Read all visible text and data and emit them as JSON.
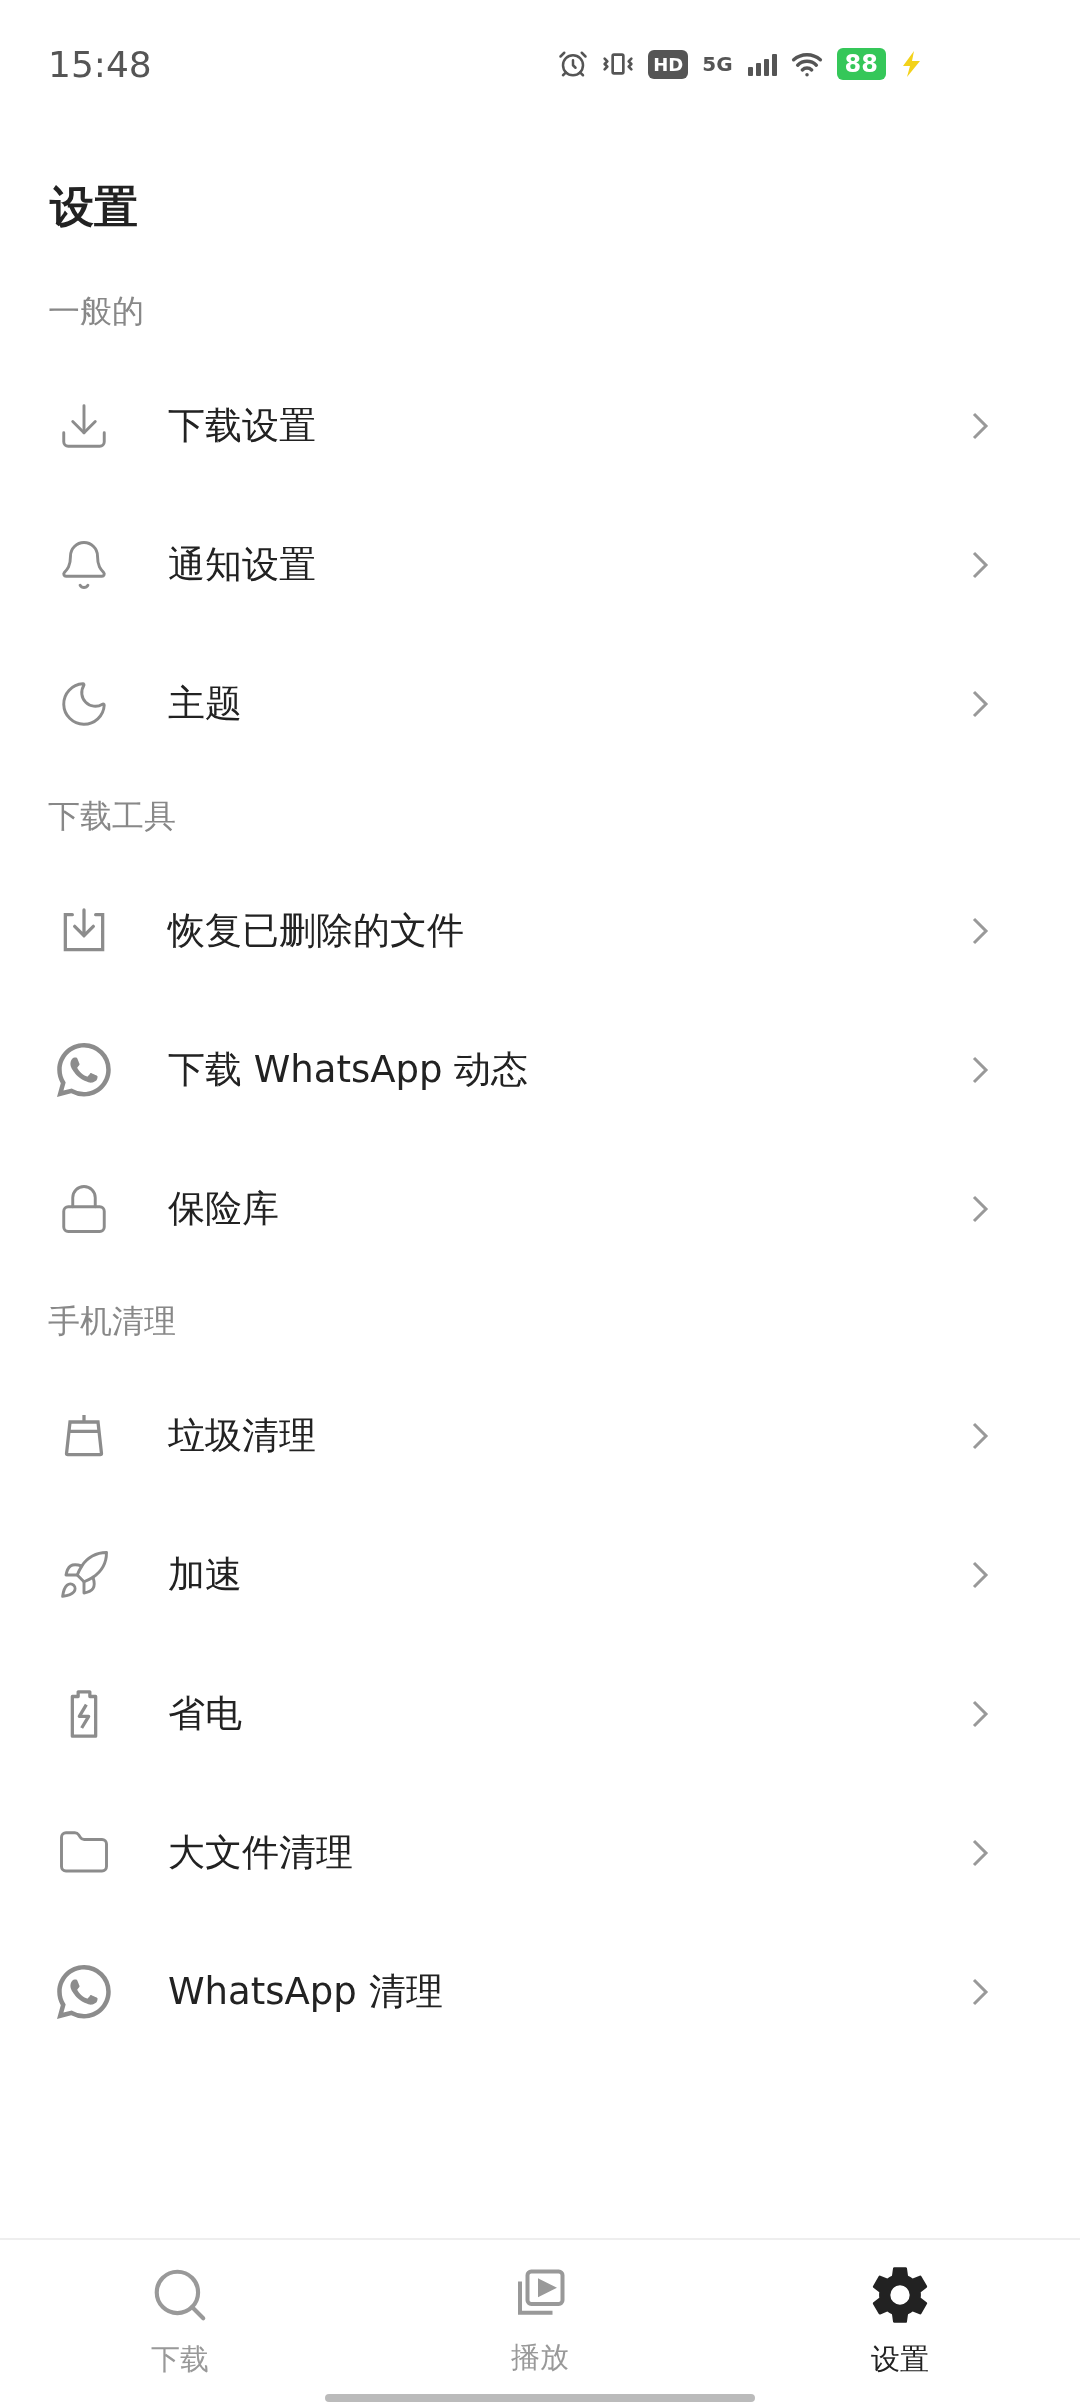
{
  "status_bar": {
    "time": "15:48",
    "network": "5G",
    "hd": "HD",
    "battery": "88"
  },
  "title": "设置",
  "sections": [
    {
      "header": "一般的",
      "items": [
        {
          "label": "下载设置"
        },
        {
          "label": "通知设置"
        },
        {
          "label": "主题"
        }
      ]
    },
    {
      "header": "下载工具",
      "items": [
        {
          "label": "恢复已删除的文件"
        },
        {
          "label": "下载 WhatsApp 动态"
        },
        {
          "label": "保险库"
        }
      ]
    },
    {
      "header": "手机清理",
      "items": [
        {
          "label": "垃圾清理"
        },
        {
          "label": "加速"
        },
        {
          "label": "省电"
        },
        {
          "label": "大文件清理"
        },
        {
          "label": "WhatsApp 清理"
        }
      ]
    }
  ],
  "bottom_nav": [
    {
      "label": "下载",
      "selected": false
    },
    {
      "label": "播放",
      "selected": false
    },
    {
      "label": "设置",
      "selected": true
    }
  ]
}
